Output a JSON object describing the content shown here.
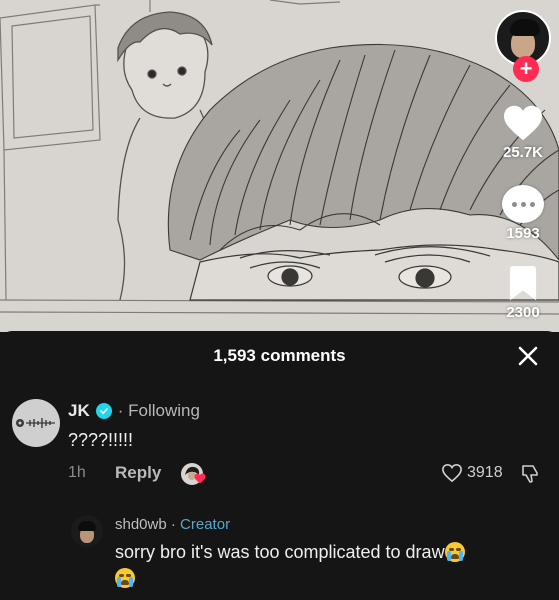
{
  "video": {
    "likes": "25.7K",
    "comments": "1593",
    "saves": "2300"
  },
  "panel": {
    "title": "1,593 comments"
  },
  "comment": {
    "author": "JK",
    "relation": "Following",
    "text": "????!!!!!",
    "time": "1h",
    "reply_label": "Reply",
    "like_count": "3918"
  },
  "reply": {
    "author": "shd0wb",
    "badge": "Creator",
    "text": "sorry bro it's was too complicated to draw"
  },
  "colors": {
    "accent": "#fe2c55",
    "creator": "#58a7c9",
    "verified": "#20d5ec",
    "panel_bg": "#151515"
  },
  "icons": [
    "plus-icon",
    "heart-icon",
    "comment-icon",
    "bookmark-icon",
    "close-icon",
    "verified-icon",
    "heart-outline-icon",
    "dislike-icon",
    "loudly-crying-face-emoji"
  ]
}
